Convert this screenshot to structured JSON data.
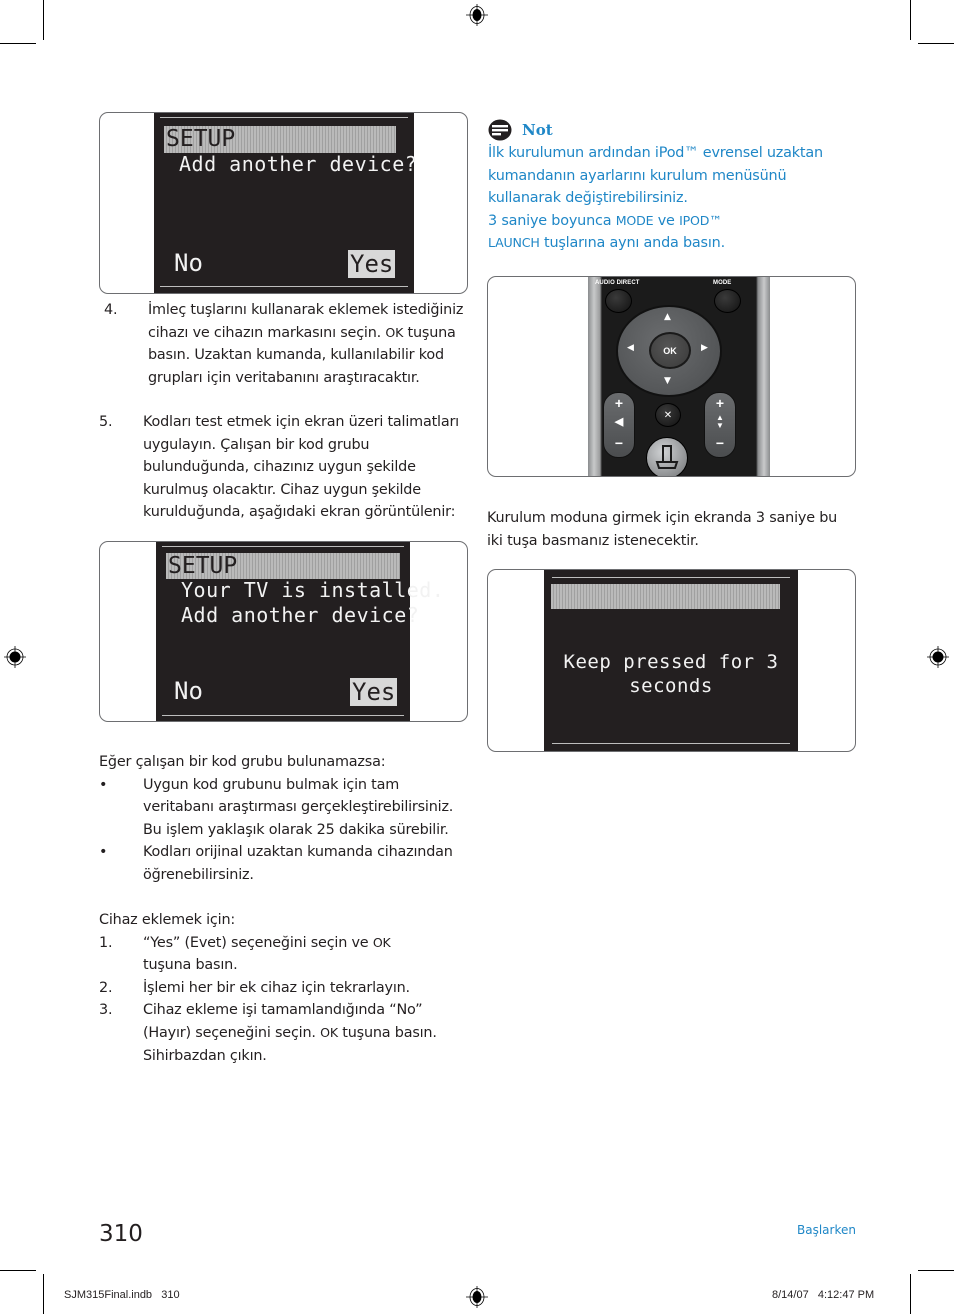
{
  "page": {
    "number": "310",
    "section": "Başlarken"
  },
  "slug": {
    "file": "SJM315Final.indb   310",
    "timestamp": "8/14/07   4:12:47 PM"
  },
  "screens": {
    "add_device": {
      "title": "SETUP",
      "lines": [
        "Add another device?"
      ],
      "option_no": "No",
      "option_yes": "Yes"
    },
    "tv_installed": {
      "title": "SETUP",
      "lines": [
        "Your TV is installed.",
        "Add another device?"
      ],
      "option_no": "No",
      "option_yes": "Yes"
    },
    "keep_pressed": {
      "lines": [
        "Keep pressed for 3",
        "seconds"
      ]
    }
  },
  "left_column": {
    "steps_a": [
      {
        "num": "4.",
        "text_before": "İmleç tuşlarını kullanarak eklemek istediğiniz cihazı ve cihazın markasını seçin. ",
        "key": "OK",
        "text_after": " tuşuna basın. Uzaktan kumanda, kullanılabilir kod grupları için veritabanını araştıracaktır."
      },
      {
        "num": "5.",
        "text_before": "Kodları test etmek için ekran üzeri talimatları uygulayın. Çalışan bir kod grubu bulunduğunda, cihazınız uygun şekilde kurulmuş olacaktır. Cihaz uygun şekilde kurulduğunda, aşağıdaki ekran görüntülenir:",
        "key": "",
        "text_after": ""
      }
    ],
    "not_found_heading": "Eğer çalışan bir kod grubu bulunamazsa:",
    "bullets": [
      {
        "mark": "•",
        "text": "Uygun kod grubunu bulmak için tam veritabanı araştırması gerçekleştirebilirsiniz. Bu işlem yaklaşık olarak 25 dakika sürebilir."
      },
      {
        "mark": "•",
        "text": "Kodları orijinal uzaktan kumanda cihazından öğrenebilirsiniz."
      }
    ],
    "add_heading": "Cihaz eklemek için:",
    "steps_b": [
      {
        "num": "1.",
        "text_before": "“Yes” (Evet) seçeneğini seçin ve ",
        "key": "OK",
        "text_after": " tuşuna basın."
      },
      {
        "num": "2.",
        "text_before": "İşlemi her bir ek cihaz için tekrarlayın.",
        "key": "",
        "text_after": ""
      },
      {
        "num": "3.",
        "text_before": "Cihaz ekleme işi tamamlandığında “No” (Hayır) seçeneğini seçin. ",
        "key": "OK",
        "text_after": " tuşuna basın. Sihirbazdan çıkın."
      }
    ]
  },
  "note": {
    "title": "Not",
    "icon": "note-icon",
    "paragraph1": "İlk kurulumun ardından iPod™ evrensel uzaktan kumandanın ayarlarını kurulum menüsünü kullanarak değiştirebilirsiniz.",
    "p2_before": "3 saniye boyunca ",
    "p2_key1": "MODE",
    "p2_mid": " ve ",
    "p2_key2": "IPOD™ LAUNCH",
    "p2_after": " tuşlarına aynı anda basın.",
    "accent_color": "#1f87c7"
  },
  "remote": {
    "label_audio_direct": "AUDIO DIRECT",
    "label_mode": "MODE",
    "ok_label": "OK",
    "vol_plus": "+",
    "vol_minus": "−",
    "ch_plus": "+",
    "ch_minus": "−"
  },
  "right_column": {
    "instruction": "Kurulum moduna girmek için ekranda 3 saniye bu iki tuşa basmanız istenecektir."
  }
}
